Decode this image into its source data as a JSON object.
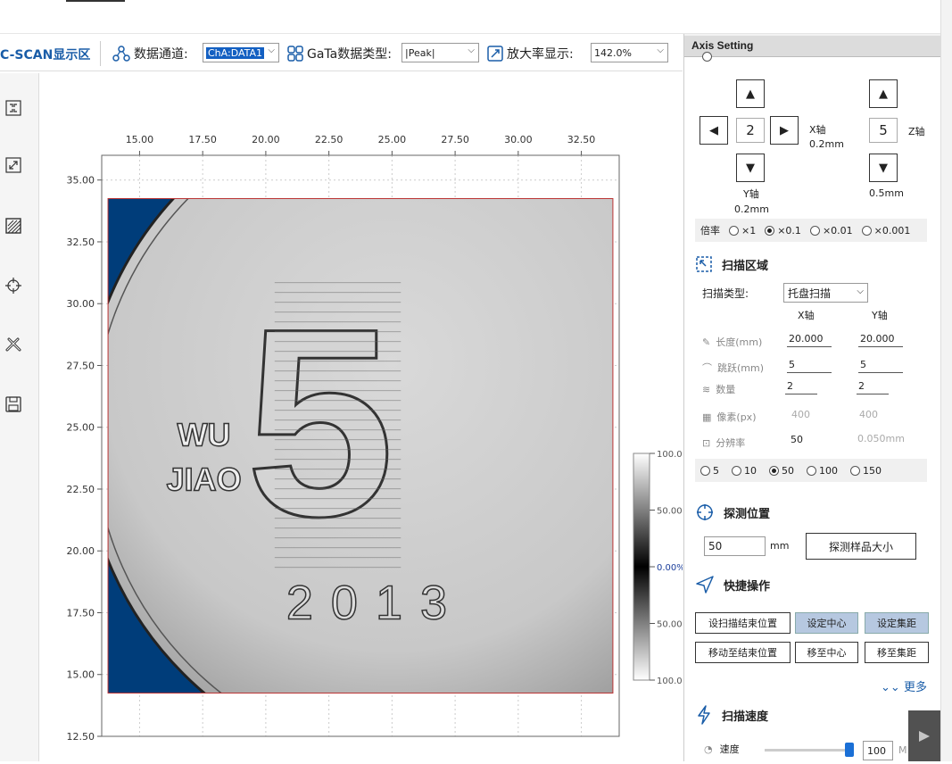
{
  "toolbar": {
    "title": "C-SCAN显示区",
    "channel_label": "数据通道:",
    "channel_value": "ChA:DATA1",
    "gata_label": "GaTa数据类型:",
    "gata_value": "|Peak|",
    "zoom_label": "放大率显示:",
    "zoom_value": "142.0%"
  },
  "rail": {
    "icons": [
      "fit-icon",
      "expand-icon",
      "hatch-icon",
      "crosshair-icon",
      "tools-icon",
      "save-icon"
    ]
  },
  "chart_data": {
    "type": "heatmap",
    "title": "",
    "xlabel": "",
    "ylabel": "",
    "x_ticks": [
      "15.00",
      "17.50",
      "20.00",
      "22.50",
      "25.00",
      "27.50",
      "30.00",
      "32.50"
    ],
    "y_ticks": [
      "35.00",
      "32.50",
      "30.00",
      "27.50",
      "25.00",
      "22.50",
      "20.00",
      "17.50",
      "15.00",
      "12.50"
    ],
    "xlim": [
      13.5,
      34.0
    ],
    "ylim": [
      12.5,
      36.0
    ],
    "scan_area": {
      "x": [
        13.75,
        33.75
      ],
      "y": [
        14.25,
        34.25
      ]
    },
    "colorbar_labels": [
      "100.0",
      "50.00",
      "0.00%",
      "50.00",
      "100.0"
    ],
    "coin_text": [
      "WU",
      "JIAO",
      "2013",
      "5"
    ],
    "background_color": "#003d7a",
    "grid": true
  },
  "panel": {
    "title": "Axis Setting",
    "x_axis_label": "X轴",
    "x_axis_step": "0.2mm",
    "x_value": "2",
    "y_axis_label": "Y轴",
    "y_axis_step": "0.2mm",
    "z_axis_label": "Z轴",
    "z_axis_step": "0.5mm",
    "z_value": "5",
    "ratio_label": "倍率",
    "ratio_options": [
      "×1",
      "×0.1",
      "×0.01",
      "×0.001"
    ],
    "ratio_selected": "×0.1",
    "scan_area_title": "扫描区域",
    "scan_type_label": "扫描类型:",
    "scan_type_value": "托盘扫描",
    "col_x": "X轴",
    "col_y": "Y轴",
    "fields": [
      {
        "label": "长度(mm)",
        "x": "20.000",
        "y": "20.000"
      },
      {
        "label": "跳跃(mm)",
        "x": "5",
        "y": "5"
      },
      {
        "label": "数量",
        "x": "2",
        "y": "2"
      },
      {
        "label": "像素(px)",
        "x": "400",
        "y": "400"
      },
      {
        "label": "分辨率",
        "x": "50",
        "y": "0.050mm"
      }
    ],
    "resolution_options": [
      "5",
      "10",
      "50",
      "100",
      "150"
    ],
    "resolution_selected": "50",
    "detect_title": "探测位置",
    "detect_value": "50",
    "detect_unit": "mm",
    "detect_button": "探测样品大小",
    "quick_title": "快捷操作",
    "quick_buttons": [
      "设扫描结束位置",
      "设定中心",
      "设定集距",
      "移动至结束位置",
      "移至中心",
      "移至集距"
    ],
    "more_label": "更多",
    "speed_title": "扫描速度",
    "speed_label": "速度",
    "speed_value": "100",
    "speed_unit": "M"
  }
}
